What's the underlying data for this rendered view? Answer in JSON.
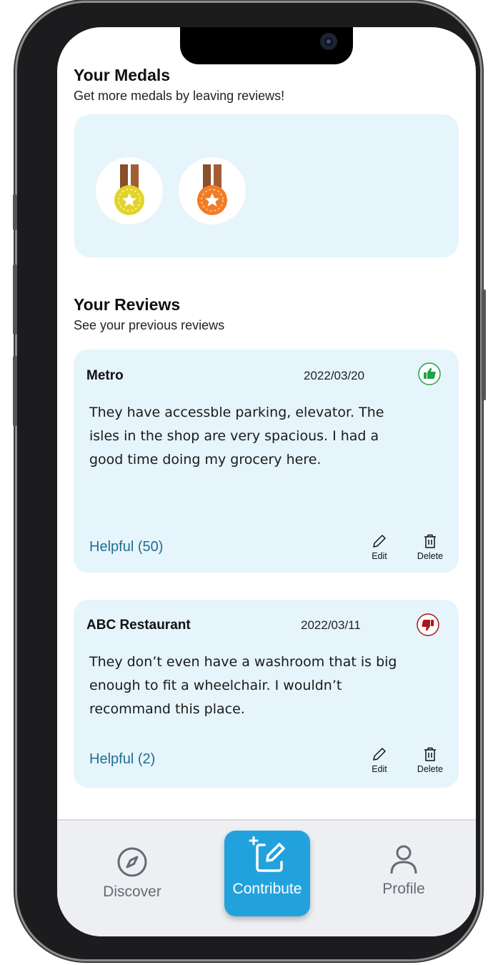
{
  "medals": {
    "title": "Your Medals",
    "subtitle": "Get more medals by leaving reviews!",
    "items": [
      {
        "icon": "gold-medal-icon",
        "color": "#e2d32a"
      },
      {
        "icon": "bronze-medal-icon",
        "color": "#f27c25"
      }
    ]
  },
  "reviews": {
    "title": "Your Reviews",
    "subtitle": "See your previous reviews",
    "items": [
      {
        "place": "Metro",
        "date": "2022/03/20",
        "rating": "thumbs-up",
        "text": "They have accessble parking, elevator. The isles in the shop are very spacious. I had a good time doing my grocery here.",
        "helpful": "Helpful (50)",
        "edit_label": "Edit",
        "delete_label": "Delete"
      },
      {
        "place": "ABC Restaurant",
        "date": "2022/03/11",
        "rating": "thumbs-down",
        "text": "They don’t even have a washroom that is big enough to fit a wheelchair. I wouldn’t recommand this place.",
        "helpful": "Helpful (2)",
        "edit_label": "Edit",
        "delete_label": "Delete"
      }
    ]
  },
  "nav": {
    "discover": "Discover",
    "contribute": "Contribute",
    "profile": "Profile"
  },
  "colors": {
    "accent": "#22a2dd",
    "card_bg": "#e6f4fc",
    "helpful": "#1f6f8f",
    "thumbs_up": "#1fa24a",
    "thumbs_down": "#b0121a"
  }
}
